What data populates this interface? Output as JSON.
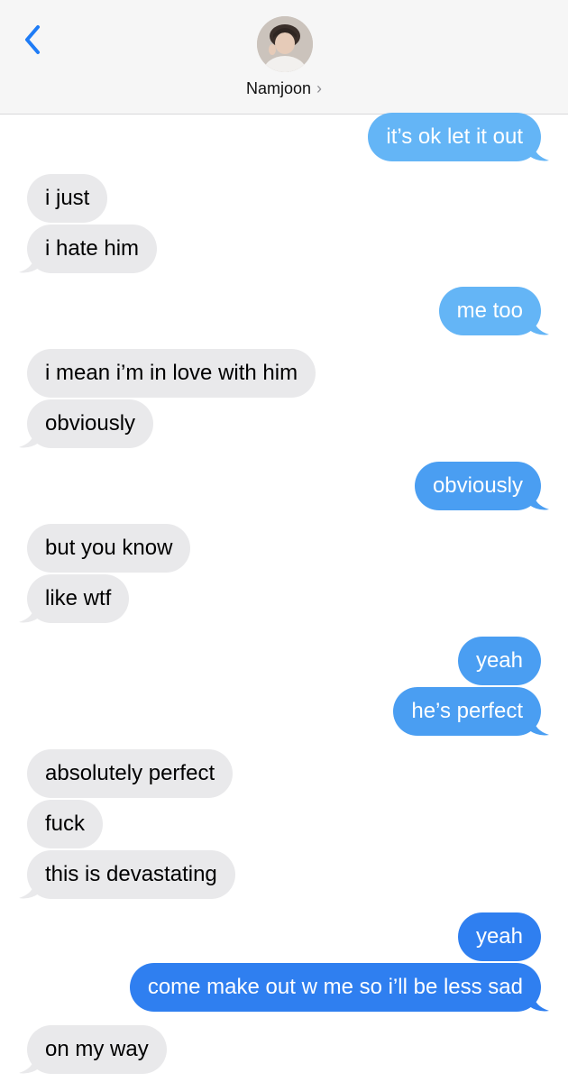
{
  "header": {
    "contact_name": "Namjoon",
    "chevron": "›",
    "back_icon": "chevron-left-icon"
  },
  "colors": {
    "outgoing_light": "#64b5f6",
    "outgoing_mid": "#4a9ef2",
    "outgoing_dark": "#2f7ff0",
    "incoming": "#e9e9eb",
    "ios_blue": "#1f7cf6"
  },
  "messages": [
    {
      "from": "me",
      "text": "it’s ok let it out"
    },
    {
      "from": "them",
      "text": "i just"
    },
    {
      "from": "them",
      "text": "i hate him"
    },
    {
      "from": "me",
      "text": "me too"
    },
    {
      "from": "them",
      "text": "i mean i’m in love with him"
    },
    {
      "from": "them",
      "text": "obviously"
    },
    {
      "from": "me",
      "text": "obviously"
    },
    {
      "from": "them",
      "text": "but you know"
    },
    {
      "from": "them",
      "text": "like wtf"
    },
    {
      "from": "me",
      "text": "yeah"
    },
    {
      "from": "me",
      "text": "he’s perfect"
    },
    {
      "from": "them",
      "text": "absolutely perfect"
    },
    {
      "from": "them",
      "text": "fuck"
    },
    {
      "from": "them",
      "text": "this is devastating"
    },
    {
      "from": "me",
      "text": "yeah"
    },
    {
      "from": "me",
      "text": "come make out w me so i’ll be less sad"
    },
    {
      "from": "them",
      "text": "on my way"
    }
  ]
}
